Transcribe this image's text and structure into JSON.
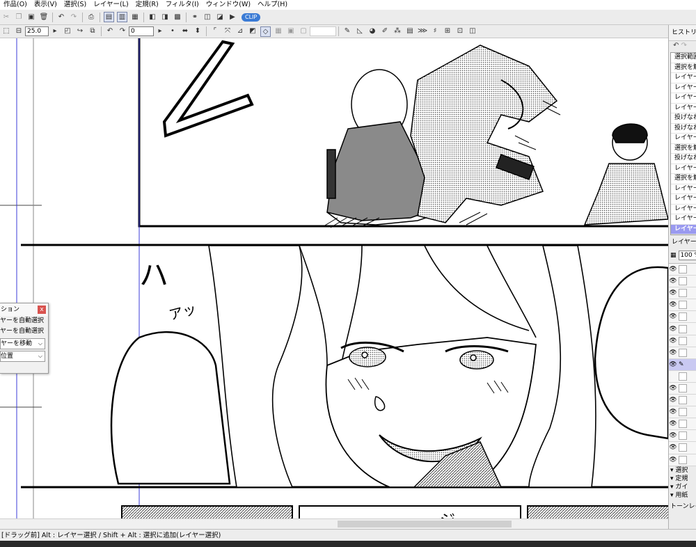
{
  "menubar": {
    "items": [
      "作品(O)",
      "表示(V)",
      "選択(S)",
      "レイヤー(L)",
      "定規(R)",
      "フィルタ(I)",
      "ウィンドウ(W)",
      "ヘルプ(H)"
    ]
  },
  "toolbar2": {
    "brush_size": "25.0",
    "angle": "0"
  },
  "history_panel": {
    "title": "ヒストリー",
    "items": [
      "選択範囲",
      "選択を解",
      "レイヤー",
      "レイヤー",
      "レイヤー",
      "レイヤー",
      "投げなわ",
      "投げなわ",
      "レイヤー",
      "選択を解",
      "投げなわ",
      "レイヤー",
      "選択を解",
      "レイヤー",
      "レイヤー",
      "レイヤー",
      "レイヤー(",
      "レイヤー"
    ],
    "selected_index": 17
  },
  "layer_panel": {
    "title": "レイヤー",
    "opacity": "100 %",
    "groups": [
      "選択",
      "定規",
      "ガイ",
      "用紙"
    ],
    "tone_label": "トーンレイヤ"
  },
  "float_panel": {
    "title": "ション",
    "items": [
      "ヤーを自動選択",
      "ヤーを自動選択"
    ],
    "select1": "ヤーを移動",
    "select2": "位置"
  },
  "manga_text": {
    "sfx1": "ハ",
    "sfx2": "アッ",
    "sfx3": "ジ"
  },
  "status": {
    "text": "[ドラッグ前] Alt : レイヤー選択 / Shift + Alt : 選択に追加(レイヤー選択)"
  },
  "colors": {
    "accent": "#9a9af0",
    "guide_line": "#3b3bd9",
    "close_button": "#d9534f"
  }
}
